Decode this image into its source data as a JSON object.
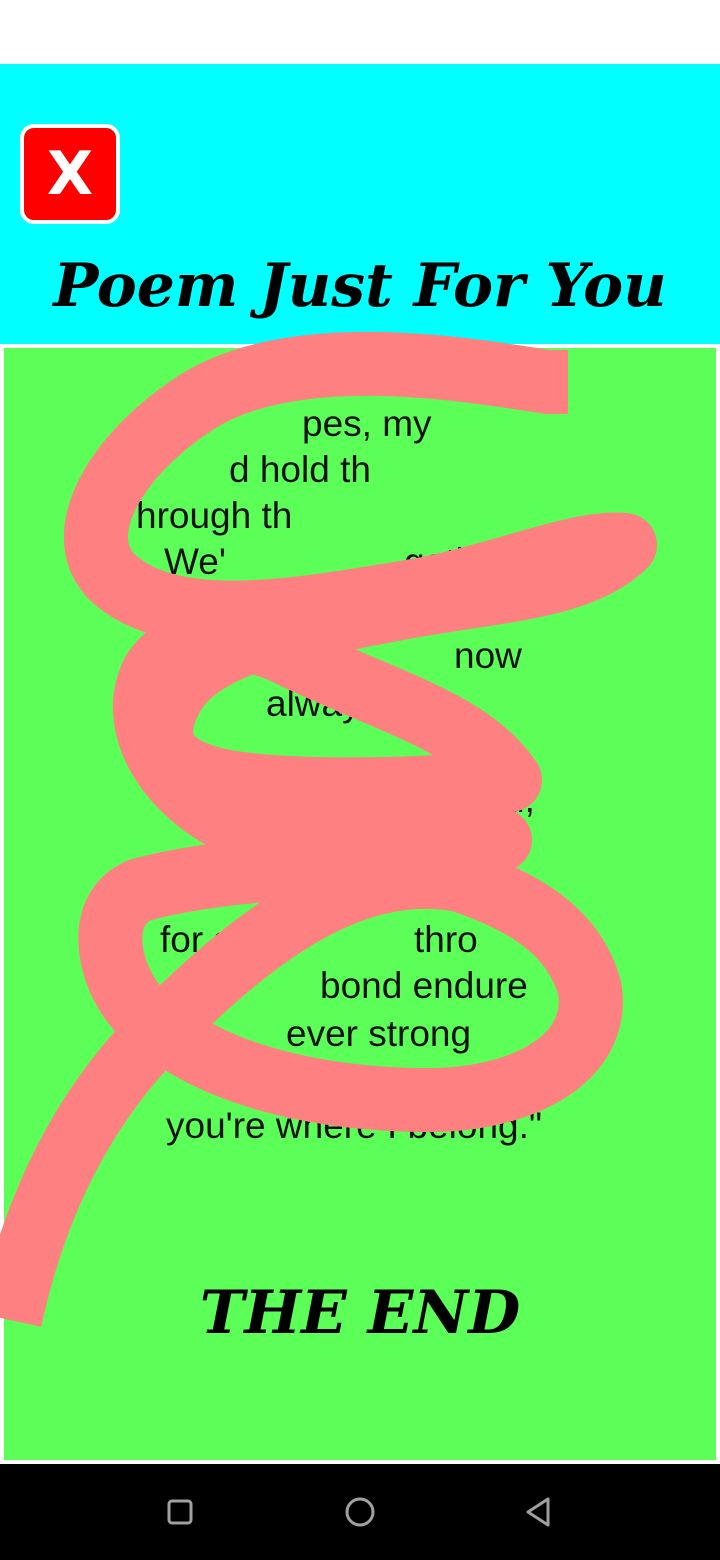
{
  "header": {
    "close_label": "X",
    "title": "Poem Just For You"
  },
  "poem": {
    "lines": [
      "pes, my",
      "d hold th",
      "hrough th",
      "We'",
      "gether,",
      "e by side,",
      "now",
      "always",
      "d,",
      "for see",
      "thro",
      "Ma",
      "bond endure",
      "ever strong",
      "you're where I belong.\""
    ],
    "end_title": "THE END"
  },
  "colors": {
    "header_bg": "#00ffff",
    "content_bg": "#5cff57",
    "close_bg": "#ff0000",
    "scribble": "#ff8080",
    "nav_bg": "#000000"
  },
  "nav": {
    "icons": [
      "recents-square-icon",
      "home-circle-icon",
      "back-triangle-icon"
    ]
  }
}
